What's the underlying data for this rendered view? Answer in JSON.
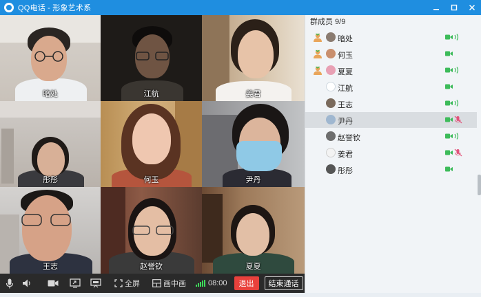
{
  "window": {
    "title": "QQ电话 - 形象艺术系"
  },
  "tiles": [
    {
      "name": "暗处"
    },
    {
      "name": "江航"
    },
    {
      "name": "姜君"
    },
    {
      "name": "彤彤"
    },
    {
      "name": "何玉"
    },
    {
      "name": "尹丹"
    },
    {
      "name": "王志"
    },
    {
      "name": "赵誉钦"
    },
    {
      "name": "夏夏"
    }
  ],
  "toolbar": {
    "fullscreen_label": "全屏",
    "pip_label": "画中画",
    "timer": "08:00",
    "exit_label": "退出",
    "end_call_label": "结束通话"
  },
  "panel": {
    "header": "群成员 9/9",
    "members": [
      {
        "name": "暗处",
        "host": true,
        "speaking": true,
        "mic_muted": false
      },
      {
        "name": "何玉",
        "host": true,
        "speaking": false,
        "mic_muted": false
      },
      {
        "name": "夏夏",
        "host": true,
        "speaking": true,
        "mic_muted": false
      },
      {
        "name": "江航",
        "host": false,
        "speaking": false,
        "mic_muted": false
      },
      {
        "name": "王志",
        "host": false,
        "speaking": true,
        "mic_muted": false
      },
      {
        "name": "尹丹",
        "host": false,
        "speaking": false,
        "mic_muted": true,
        "selected": true
      },
      {
        "name": "赵誉钦",
        "host": false,
        "speaking": true,
        "mic_muted": false
      },
      {
        "name": "姜君",
        "host": false,
        "speaking": false,
        "mic_muted": true
      },
      {
        "name": "彤彤",
        "host": false,
        "speaking": false,
        "mic_muted": false
      }
    ]
  },
  "colors": {
    "titlebar": "#1f8ee0",
    "exit_button": "#e8413c",
    "camera_icon": "#3dbb5a",
    "muted_icon": "#e2527a",
    "signal": "#3ddc5a"
  }
}
